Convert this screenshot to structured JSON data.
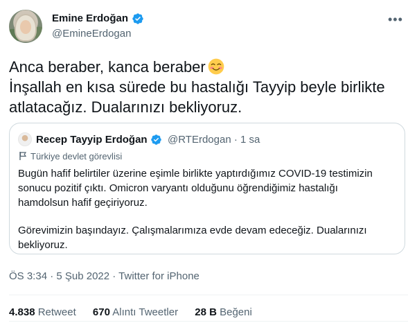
{
  "author": {
    "name": "Emine Erdoğan",
    "handle": "@EmineErdogan",
    "avatar_icon": "profile-photo",
    "verified_icon": "verified-badge-icon"
  },
  "tweet": {
    "lines": [
      "Anca beraber, kanca beraber",
      "İnşallah en kısa sürede bu hastalığı Tayyip beyle birlikte",
      "atlatacağız. Dualarınızı bekliyoruz."
    ],
    "emoji": "smiling-face-icon"
  },
  "quote": {
    "name": "Recep Tayyip Erdoğan",
    "handle": "@RTErdogan",
    "separator": "·",
    "time": "1 sa",
    "label": "Türkiye devlet görevlisi",
    "body_lines": [
      "Bugün hafif belirtiler üzerine eşimle birlikte yaptırdığımız COVID-19 testimizin",
      "sonucu pozitif çıktı. Omicron varyantı olduğunu öğrendiğimiz hastalığı",
      "hamdolsun hafif geçiriyoruz.",
      "",
      "Görevimizin başındayız. Çalışmalarımıza evde devam edeceğiz. Dualarınızı",
      "bekliyoruz."
    ]
  },
  "meta": {
    "text": "ÖS 3:34 · 5 Şub 2022 · Twitter for iPhone"
  },
  "stats": {
    "retweets_count": "4.838",
    "retweets_label": "Retweet",
    "quotes_count": "670",
    "quotes_label": "Alıntı Tweetler",
    "likes_count": "28 B",
    "likes_label": "Beğeni"
  },
  "colors": {
    "verified": "#1d9bf0",
    "secondary_text": "#536471",
    "border": "#cfd9de"
  }
}
